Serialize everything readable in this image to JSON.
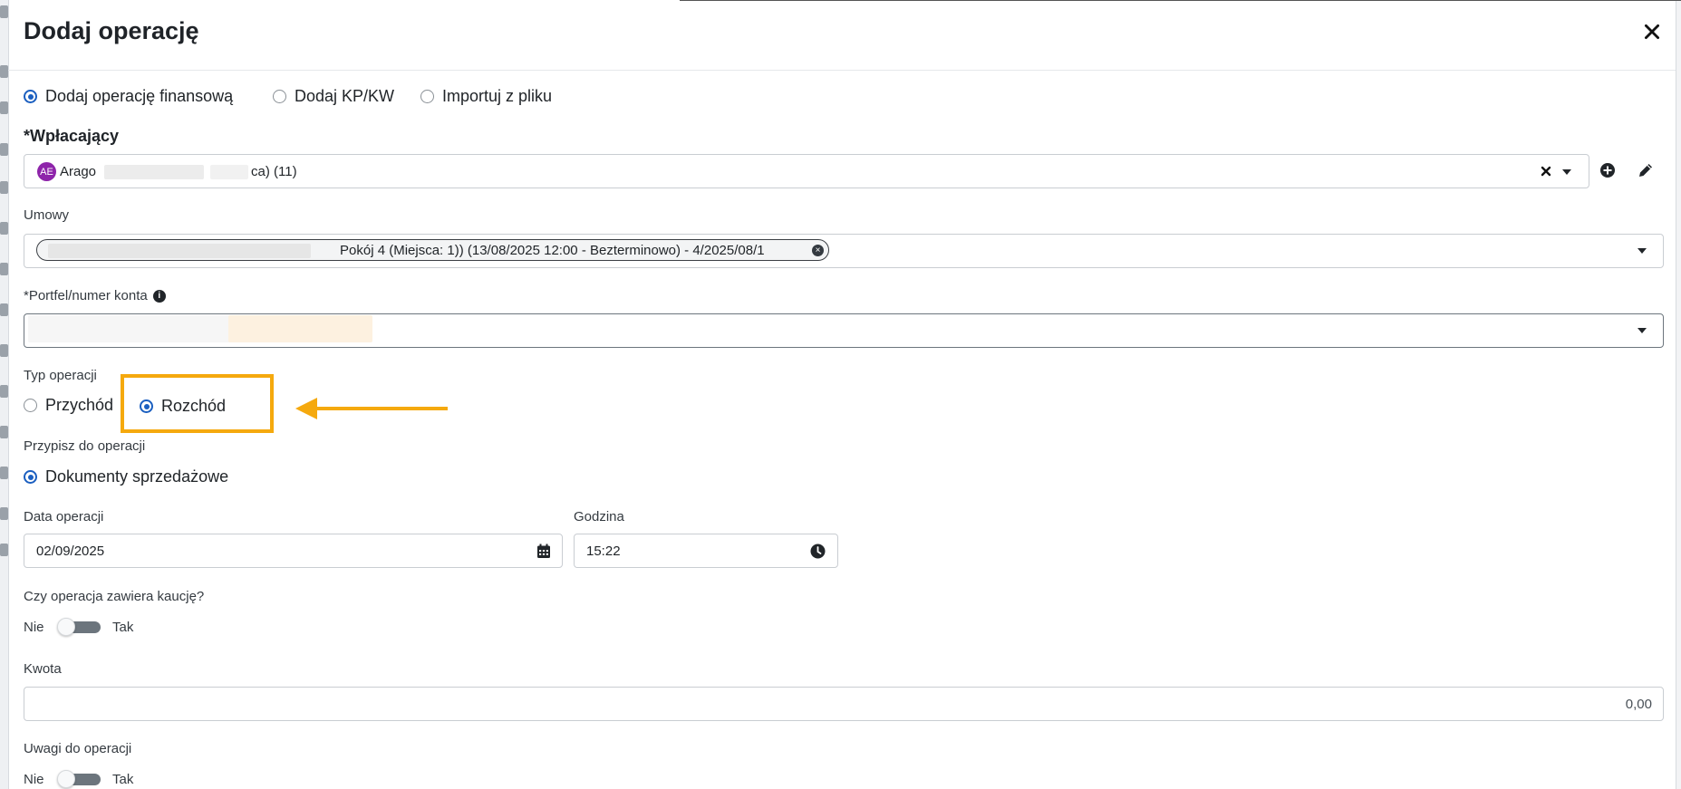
{
  "modal": {
    "title": "Dodaj operację"
  },
  "mode_options": [
    {
      "label": "Dodaj operację finansową",
      "selected": true
    },
    {
      "label": "Dodaj KP/KW",
      "selected": false
    },
    {
      "label": "Importuj z pliku",
      "selected": false
    }
  ],
  "payer": {
    "label": "*Wpłacający",
    "avatar_initials": "AE",
    "value_prefix": "Arago",
    "value_suffix": "ca) (11)"
  },
  "contracts": {
    "label": "Umowy",
    "tag_text": "Pokój 4 (Miejsca: 1)) (13/08/2025 12:00 - Bezterminowo) - 4/2025/08/1"
  },
  "account": {
    "label": "*Portfel/numer konta"
  },
  "operation_type": {
    "label": "Typ operacji",
    "options": [
      {
        "label": "Przychód",
        "selected": false
      },
      {
        "label": "Rozchód",
        "selected": true
      }
    ]
  },
  "assign": {
    "label": "Przypisz do operacji",
    "option": "Dokumenty sprzedażowe"
  },
  "date": {
    "label": "Data operacji",
    "value": "02/09/2025"
  },
  "time": {
    "label": "Godzina",
    "value": "15:22"
  },
  "deposit": {
    "label": "Czy operacja zawiera kaucję?",
    "off_label": "Nie",
    "on_label": "Tak",
    "enabled": false
  },
  "amount": {
    "label": "Kwota",
    "value": "0,00"
  },
  "notes": {
    "label": "Uwagi do operacji",
    "off_label": "Nie",
    "on_label": "Tak",
    "enabled": false
  },
  "colors": {
    "accent": "#1b5fc0",
    "highlight": "#f5a90e",
    "avatar": "#8e24aa"
  },
  "icons": {
    "close": "close-icon",
    "clear": "clear-icon",
    "add": "plus-circle-icon",
    "edit": "pencil-icon",
    "info": "info-icon",
    "calendar": "calendar-icon",
    "clock": "clock-icon"
  }
}
